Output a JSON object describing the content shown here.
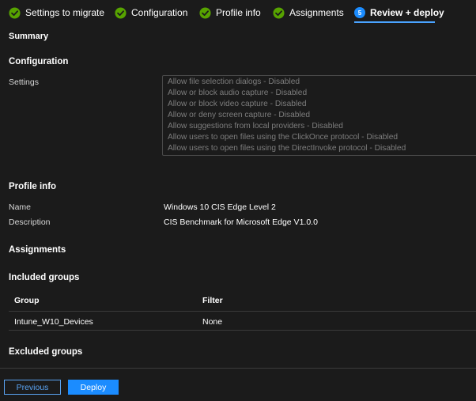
{
  "steps": [
    {
      "label": "Settings to migrate",
      "state": "complete"
    },
    {
      "label": "Configuration",
      "state": "complete"
    },
    {
      "label": "Profile info",
      "state": "complete"
    },
    {
      "label": "Assignments",
      "state": "complete"
    },
    {
      "label": "Review + deploy",
      "state": "active",
      "number": "5"
    }
  ],
  "summary_heading": "Summary",
  "configuration": {
    "heading": "Configuration",
    "settings_label": "Settings",
    "settings": [
      "Allow file selection dialogs - Disabled",
      "Allow or block audio capture - Disabled",
      "Allow or block video capture - Disabled",
      "Allow or deny screen capture - Disabled",
      "Allow suggestions from local providers - Disabled",
      "Allow users to open files using the ClickOnce protocol - Disabled",
      "Allow users to open files using the DirectInvoke protocol - Disabled"
    ]
  },
  "profile_info": {
    "heading": "Profile info",
    "name_label": "Name",
    "name_value": "Windows 10 CIS Edge Level 2",
    "description_label": "Description",
    "description_value": "CIS Benchmark for Microsoft Edge V1.0.0"
  },
  "assignments": {
    "heading": "Assignments",
    "included_heading": "Included groups",
    "columns": [
      "Group",
      "Filter"
    ],
    "rows": [
      {
        "group": "Intune_W10_Devices",
        "filter": "None"
      }
    ],
    "excluded_heading": "Excluded groups"
  },
  "footer": {
    "previous_label": "Previous",
    "deploy_label": "Deploy"
  },
  "colors": {
    "background": "#1b1b1b",
    "check_green": "#57a300",
    "accent_blue": "#1b8cff"
  },
  "icons": {
    "complete": "check-circle-icon",
    "active": "step-number-icon"
  }
}
